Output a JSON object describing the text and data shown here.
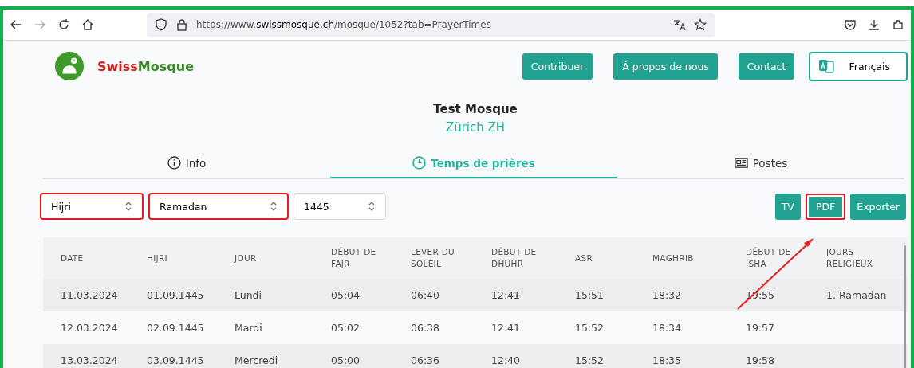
{
  "browser": {
    "url_host": "https://www.",
    "url_domain": "swissmosque.ch",
    "url_path": "/mosque/1052?tab=PrayerTimes"
  },
  "site": {
    "logo_part1": "Swiss",
    "logo_part2": "Mosque",
    "nav": [
      "Contribuer",
      "À propos de nous",
      "Contact"
    ],
    "language": "Français"
  },
  "mosque": {
    "name": "Test Mosque",
    "location": "Zürich ZH"
  },
  "tabs": [
    {
      "label": "Info",
      "selected": false
    },
    {
      "label": "Temps de prières",
      "selected": true
    },
    {
      "label": "Postes",
      "selected": false
    }
  ],
  "filters": [
    {
      "value": "Hijri",
      "highlighted": true
    },
    {
      "value": "Ramadan",
      "highlighted": true
    },
    {
      "value": "1445",
      "highlighted": false
    }
  ],
  "actions": [
    {
      "label": "TV",
      "highlighted": false
    },
    {
      "label": "PDF",
      "highlighted": true
    },
    {
      "label": "Exporter",
      "highlighted": false
    }
  ],
  "table": {
    "columns": [
      "DATE",
      "HIJRI",
      "JOUR",
      "DÉBUT DE FAJR",
      "LEVER DU SOLEIL",
      "DÉBUT DE DHUHR",
      "ASR",
      "MAGHRIB",
      "DÉBUT DE ISHA",
      "JOURS RELIGIEUX"
    ],
    "rows": [
      [
        "11.03.2024",
        "01.09.1445",
        "Lundi",
        "05:04",
        "06:40",
        "12:41",
        "15:51",
        "18:32",
        "19:55",
        "1. Ramadan"
      ],
      [
        "12.03.2024",
        "02.09.1445",
        "Mardi",
        "05:02",
        "06:38",
        "12:41",
        "15:52",
        "18:34",
        "19:57",
        ""
      ],
      [
        "13.03.2024",
        "03.09.1445",
        "Mercredi",
        "05:00",
        "06:36",
        "12:40",
        "15:52",
        "18:35",
        "19:58",
        ""
      ]
    ]
  }
}
